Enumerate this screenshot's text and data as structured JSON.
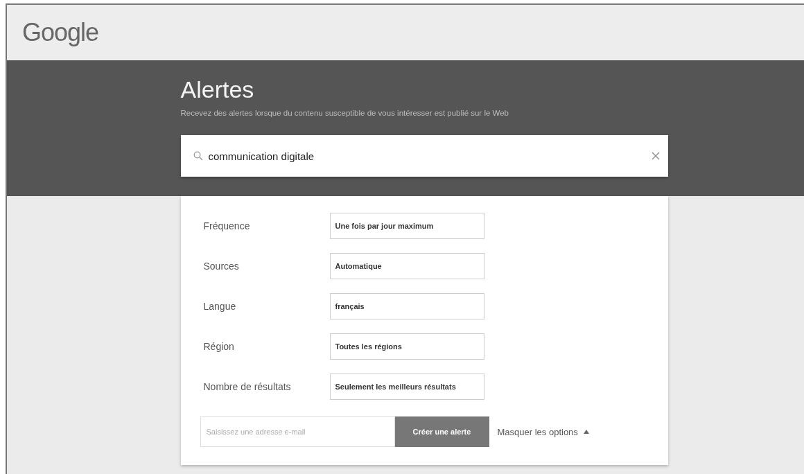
{
  "header": {
    "logo": "Google"
  },
  "hero": {
    "title": "Alertes",
    "subtitle": "Recevez des alertes lorsque du contenu susceptible de vous intéresser est publié sur le Web"
  },
  "search": {
    "value": "communication digitale"
  },
  "options": [
    {
      "label": "Fréquence",
      "value": "Une fois par jour maximum"
    },
    {
      "label": "Sources",
      "value": "Automatique"
    },
    {
      "label": "Langue",
      "value": "français"
    },
    {
      "label": "Région",
      "value": "Toutes les régions"
    },
    {
      "label": "Nombre de résultats",
      "value": "Seulement les meilleurs résultats"
    }
  ],
  "email": {
    "placeholder": "Saisissez une adresse e-mail"
  },
  "create_button": "Créer une alerte",
  "toggle_options": {
    "label": "Masquer les options",
    "expanded": true
  }
}
